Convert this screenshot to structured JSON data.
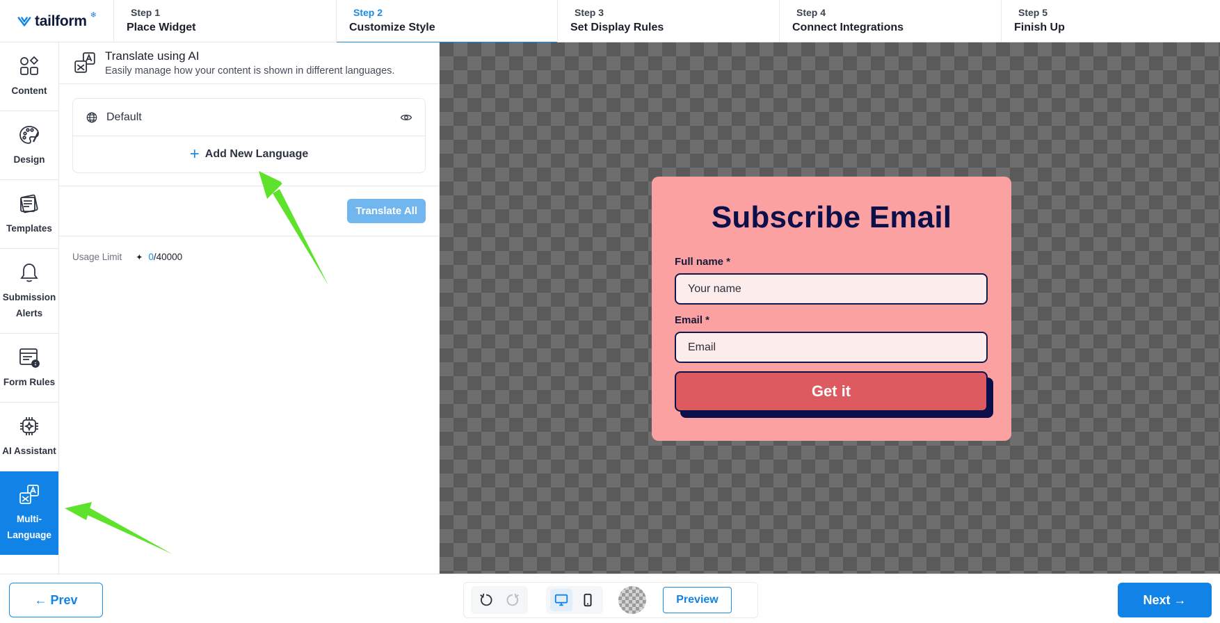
{
  "app": {
    "logo_text": "tailform",
    "logo_mark": "❄"
  },
  "steps": [
    {
      "num": "Step 1",
      "title": "Place Widget"
    },
    {
      "num": "Step 2",
      "title": "Customize Style"
    },
    {
      "num": "Step 3",
      "title": "Set Display Rules"
    },
    {
      "num": "Step 4",
      "title": "Connect Integrations"
    },
    {
      "num": "Step 5",
      "title": "Finish Up"
    }
  ],
  "active_step": "Step 2",
  "sidebar": {
    "items": [
      {
        "label": "Content",
        "icon": "shapes-icon"
      },
      {
        "label": "Design",
        "icon": "palette-icon"
      },
      {
        "label": "Templates",
        "icon": "templates-icon"
      },
      {
        "label": "Submission Alerts",
        "icon": "bell-icon"
      },
      {
        "label": "Form Rules",
        "icon": "form-rules-icon"
      },
      {
        "label": "AI Assistant",
        "icon": "ai-chip-icon"
      },
      {
        "label": "Multi-Language",
        "icon": "translate-icon"
      }
    ],
    "active": "Multi-Language"
  },
  "panel": {
    "title": "Translate using AI",
    "subtitle": "Easily manage how your content is shown in different languages.",
    "default_language": "Default",
    "add_language_label": "Add New Language",
    "translate_all_label": "Translate All",
    "usage_label": "Usage Limit",
    "usage_used": "0",
    "usage_total": "/40000"
  },
  "widget": {
    "title": "Subscribe Email",
    "fields": [
      {
        "label": "Full name *",
        "placeholder": "Your name"
      },
      {
        "label": "Email *",
        "placeholder": "Email"
      }
    ],
    "button_label": "Get it",
    "colors": {
      "background": "#fca1a2",
      "title": "#0b0f4a",
      "button": "#dd5a60",
      "input_bg": "#fdecec"
    }
  },
  "footer": {
    "prev_label": "← Prev",
    "next_label": "Next →",
    "preview_label": "Preview",
    "tools": [
      "undo-icon",
      "redo-icon",
      "desktop-icon",
      "mobile-icon",
      "transparency-toggle"
    ]
  },
  "colors": {
    "accent": "#1283e6",
    "annotation_arrow": "#5ee22b"
  }
}
